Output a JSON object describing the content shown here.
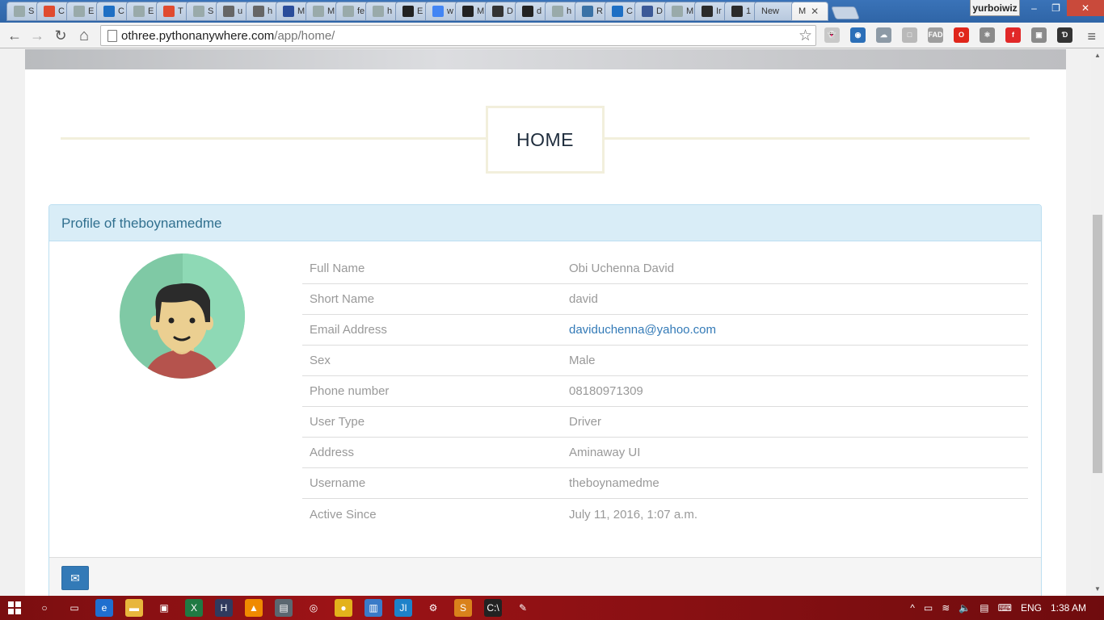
{
  "browser": {
    "tabs": [
      {
        "label": "S",
        "icon": "page-icon",
        "color": "#9aa"
      },
      {
        "label": "C",
        "icon": "shield-icon",
        "color": "#e04b2f"
      },
      {
        "label": "E",
        "icon": "page-icon",
        "color": "#9aa"
      },
      {
        "label": "C",
        "icon": "outlook-icon",
        "color": "#1d6fc4"
      },
      {
        "label": "E",
        "icon": "page-icon",
        "color": "#9aa"
      },
      {
        "label": "T",
        "icon": "shield-icon",
        "color": "#e04b2f"
      },
      {
        "label": "S",
        "icon": "page-icon",
        "color": "#9aa"
      },
      {
        "label": "u",
        "icon": "loading-icon",
        "color": "#666"
      },
      {
        "label": "h",
        "icon": "loading-icon",
        "color": "#666"
      },
      {
        "label": "M",
        "icon": "chart-icon",
        "color": "#2a4d9b"
      },
      {
        "label": "M",
        "icon": "page-icon",
        "color": "#9aa"
      },
      {
        "label": "fe",
        "icon": "page-icon",
        "color": "#9aa"
      },
      {
        "label": "h",
        "icon": "page-icon",
        "color": "#9aa"
      },
      {
        "label": "E",
        "icon": "github-icon",
        "color": "#222"
      },
      {
        "label": "w",
        "icon": "google-icon",
        "color": "#4285f4"
      },
      {
        "label": "M",
        "icon": "github-icon",
        "color": "#222"
      },
      {
        "label": "D",
        "icon": "d-icon",
        "color": "#333"
      },
      {
        "label": "d",
        "icon": "github-icon",
        "color": "#222"
      },
      {
        "label": "h",
        "icon": "page-icon",
        "color": "#9aa"
      },
      {
        "label": "R",
        "icon": "python-icon",
        "color": "#3a72a6"
      },
      {
        "label": "C",
        "icon": "outlook-icon",
        "color": "#1d6fc4"
      },
      {
        "label": "D",
        "icon": "facebook-icon",
        "color": "#3b5998"
      },
      {
        "label": "M",
        "icon": "page-icon",
        "color": "#9aa"
      },
      {
        "label": "Ir",
        "icon": "green-dot-icon",
        "color": "#2b2b2b"
      },
      {
        "label": "1",
        "icon": "green-dot-icon",
        "color": "#2b2b2b"
      },
      {
        "label": "New",
        "icon": "none",
        "color": "#9aa"
      }
    ],
    "active_tab": {
      "label": "M",
      "close": "✕"
    },
    "profile_name": "yurboiwiz",
    "window_buttons": {
      "minimize": "–",
      "maximize": "❐",
      "close": "✕"
    },
    "nav": {
      "back": "←",
      "forward": "→",
      "reload": "↻",
      "home": "⌂"
    },
    "url_host": "othree.pythonanywhere.com",
    "url_path": "/app/home/",
    "bookmark_star": "☆",
    "extensions": [
      {
        "icon": "ghost-icon",
        "glyph": "👻",
        "color": "#c8c8c8"
      },
      {
        "icon": "globe-icon",
        "glyph": "◉",
        "color": "#2b6fb8"
      },
      {
        "icon": "cloud-icon",
        "glyph": "☁",
        "color": "#8d9aa6"
      },
      {
        "icon": "cube-icon",
        "glyph": "□",
        "color": "#b9b9b9"
      },
      {
        "icon": "fad-icon",
        "glyph": "FAD",
        "color": "#9e9e9e"
      },
      {
        "icon": "opera-icon",
        "glyph": "O",
        "color": "#e0261b"
      },
      {
        "icon": "react-icon",
        "glyph": "⚛",
        "color": "#8a8a8a"
      },
      {
        "icon": "flipboard-icon",
        "glyph": "f",
        "color": "#e12828"
      },
      {
        "icon": "camera-icon",
        "glyph": "▣",
        "color": "#8a8a8a"
      },
      {
        "icon": "d-icon",
        "glyph": "Ɗ",
        "color": "#333333"
      }
    ],
    "menu": "≡"
  },
  "page": {
    "heading": "HOME",
    "panel_title": "Profile of theboynamedme",
    "profile": [
      {
        "label": "Full Name",
        "value": "Obi Uchenna David",
        "is_link": false
      },
      {
        "label": "Short Name",
        "value": "david",
        "is_link": false
      },
      {
        "label": "Email Address",
        "value": "daviduchenna@yahoo.com",
        "is_link": true
      },
      {
        "label": "Sex",
        "value": "Male",
        "is_link": false
      },
      {
        "label": "Phone number",
        "value": "08180971309",
        "is_link": false
      },
      {
        "label": "User Type",
        "value": "Driver",
        "is_link": false
      },
      {
        "label": "Address",
        "value": "Aminaway UI",
        "is_link": false
      },
      {
        "label": "Username",
        "value": "theboynamedme",
        "is_link": false
      },
      {
        "label": "Active Since",
        "value": "July 11, 2016, 1:07 a.m.",
        "is_link": false
      }
    ],
    "mail_button": "✉",
    "colors": {
      "panel_heading_bg": "#d9edf7",
      "panel_heading_text": "#31708f",
      "link": "#337ab7",
      "avatar_bg": "#7fc9a5"
    }
  },
  "scrollbar": {
    "up": "▲",
    "down": "▼"
  },
  "taskbar": {
    "apps": [
      {
        "icon": "search-icon",
        "glyph": "○",
        "color": "transparent"
      },
      {
        "icon": "task-view-icon",
        "glyph": "▭",
        "color": "transparent"
      },
      {
        "icon": "edge-icon",
        "glyph": "e",
        "color": "#1f6fcf"
      },
      {
        "icon": "folder-icon",
        "glyph": "▬",
        "color": "#e8b63c"
      },
      {
        "icon": "store-icon",
        "glyph": "▣",
        "color": "transparent"
      },
      {
        "icon": "excel-icon",
        "glyph": "X",
        "color": "#1f7a43"
      },
      {
        "icon": "app-icon",
        "glyph": "H",
        "color": "#303a5e"
      },
      {
        "icon": "vlc-icon",
        "glyph": "▲",
        "color": "#f08a00"
      },
      {
        "icon": "photos-icon",
        "glyph": "▤",
        "color": "#5b6770"
      },
      {
        "icon": "media-icon",
        "glyph": "◎",
        "color": "transparent"
      },
      {
        "icon": "chrome-icon",
        "glyph": "●",
        "color": "#e3b21b"
      },
      {
        "icon": "notepad-icon",
        "glyph": "▥",
        "color": "#3a7bc8"
      },
      {
        "icon": "jetbrains-icon",
        "glyph": "JI",
        "color": "#1d82c9"
      },
      {
        "icon": "settings-icon",
        "glyph": "⚙",
        "color": "transparent"
      },
      {
        "icon": "sublime-icon",
        "glyph": "S",
        "color": "#d9821b"
      },
      {
        "icon": "cmd-icon",
        "glyph": "C:\\",
        "color": "#222222"
      },
      {
        "icon": "paint-icon",
        "glyph": "✎",
        "color": "transparent"
      }
    ],
    "tray": {
      "chevron": "^",
      "battery": "▭",
      "wifi": "≋",
      "volume": "🔈",
      "notifications": "▤",
      "keyboard": "⌨",
      "language": "ENG",
      "time": "1:38 AM"
    }
  }
}
